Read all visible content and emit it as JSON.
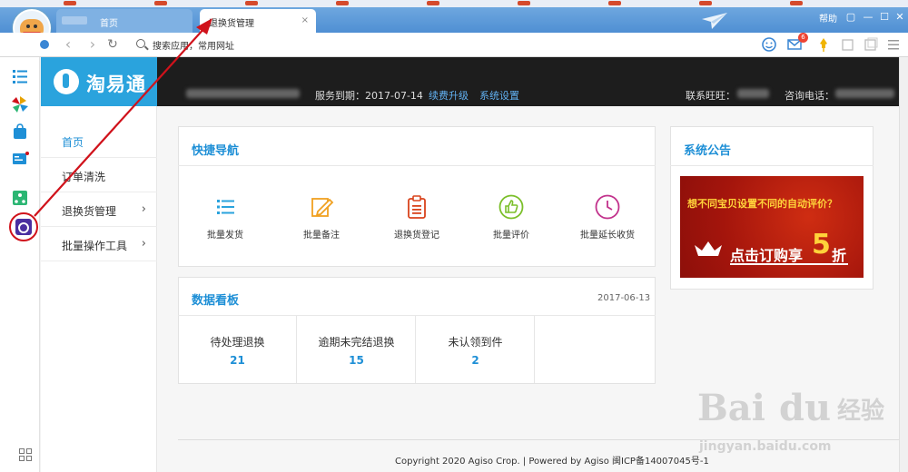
{
  "browser": {
    "tabs": [
      {
        "label": "首页"
      },
      {
        "label": "退换货管理",
        "close": "×"
      }
    ],
    "help": "帮助",
    "search_placeholder": "搜索应用，常用网址",
    "mail_count": "6",
    "window_controls": [
      "▢",
      "—",
      "☐",
      "✕"
    ]
  },
  "app": {
    "logo_text": "淘易通",
    "header": {
      "service_label": "服务到期：2017-07-14",
      "renew_link": "续费升级",
      "settings_link": "系统设置",
      "contact_label": "联系旺旺：",
      "phone_label": "咨询电话："
    },
    "menu": [
      {
        "label": "首页",
        "active": true
      },
      {
        "label": "订单清洗"
      },
      {
        "label": "退换货管理",
        "chevron": "›"
      },
      {
        "label": "批量操作工具",
        "chevron": "›"
      }
    ]
  },
  "quick_nav": {
    "title": "快捷导航",
    "items": [
      {
        "label": "批量发货",
        "icon": "list-icon",
        "color": "#2aa3dd"
      },
      {
        "label": "批量备注",
        "icon": "edit-icon",
        "color": "#f0a020"
      },
      {
        "label": "退换货登记",
        "icon": "clipboard-icon",
        "color": "#d9431c"
      },
      {
        "label": "批量评价",
        "icon": "thumbs-up-icon",
        "color": "#7bbf2a"
      },
      {
        "label": "批量延长收货",
        "icon": "clock-icon",
        "color": "#c2328c"
      }
    ]
  },
  "dashboard": {
    "title": "数据看板",
    "date": "2017-06-13",
    "stats": [
      {
        "label": "待处理退换",
        "value": "21"
      },
      {
        "label": "逾期未完结退换",
        "value": "15"
      },
      {
        "label": "未认领到件",
        "value": "2"
      }
    ]
  },
  "announcement": {
    "title": "系统公告",
    "promo_line1": "想不同宝贝设置不同的自动评价？",
    "promo_line2": "点击订购享",
    "promo_five": "5",
    "promo_zhe": "折"
  },
  "footer": {
    "text": "Copyright 2020 Agiso Crop. | Powered by Agiso 闽ICP备14007045号-1"
  },
  "watermark": {
    "brand": "Bai",
    "brand2": "du",
    "brand_cn": "经验",
    "url": "jingyan.baidu.com"
  },
  "colors": {
    "accent": "#1e8fd6",
    "header_bg": "#1d1d1d",
    "logo_bg": "#2aa3dd",
    "annotation_red": "#d0121b"
  }
}
